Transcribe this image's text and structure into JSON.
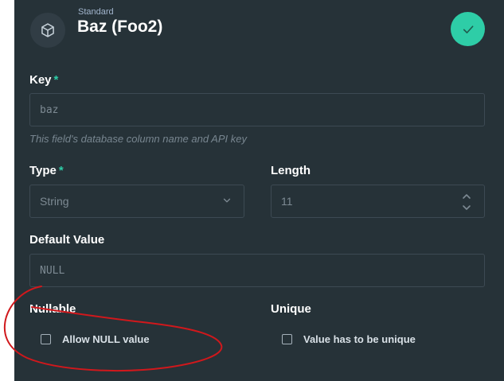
{
  "header": {
    "subtitle": "Standard",
    "title": "Baz (Foo2)",
    "icon": "cube-icon",
    "save_icon": "checkmark-icon"
  },
  "fields": {
    "key": {
      "label": "Key",
      "required_mark": "*",
      "value": "baz",
      "note": "This field's database column name and API key"
    },
    "type": {
      "label": "Type",
      "required_mark": "*",
      "value": "String"
    },
    "length": {
      "label": "Length",
      "value": "11"
    },
    "default_value": {
      "label": "Default Value",
      "value": "NULL"
    },
    "nullable": {
      "label": "Nullable",
      "checkbox_label": "Allow NULL value",
      "checked": false
    },
    "unique": {
      "label": "Unique",
      "checkbox_label": "Value has to be unique",
      "checked": false
    }
  },
  "colors": {
    "panel_bg": "#263238",
    "accent": "#2ecda7",
    "annotation": "#d0181c"
  }
}
